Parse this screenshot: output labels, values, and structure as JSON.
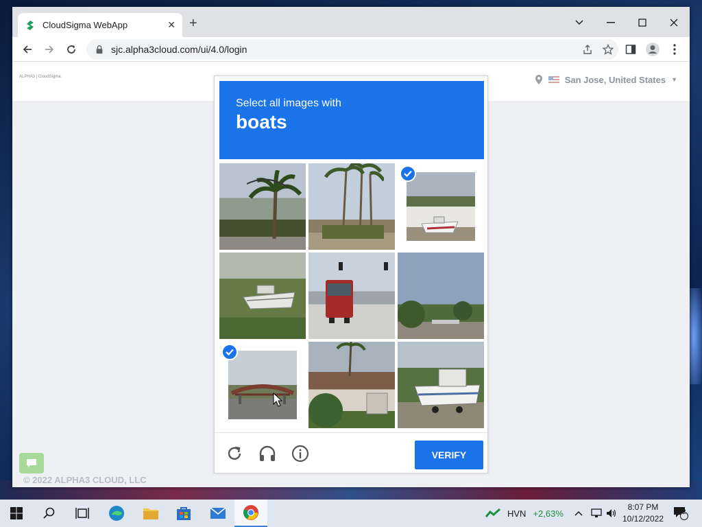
{
  "browser": {
    "tab_title": "CloudSigma WebApp",
    "url": "sjc.alpha3cloud.com/ui/4.0/login"
  },
  "page": {
    "logo_text": "ALPHA3 | CloudSigma",
    "location": "San Jose, United States",
    "footer": "© 2022 ALPHA3 CLOUD, LLC"
  },
  "captcha": {
    "instruction": "Select all images with",
    "target": "boats",
    "verify_label": "VERIFY",
    "tiles": [
      {
        "desc": "palm tree and street light",
        "selected": false
      },
      {
        "desc": "palm trees",
        "selected": false
      },
      {
        "desc": "boat on trailer in driveway",
        "selected": true
      },
      {
        "desc": "boat under tree",
        "selected": false
      },
      {
        "desc": "red bus on street",
        "selected": false
      },
      {
        "desc": "street with trees",
        "selected": false
      },
      {
        "desc": "bridge over road",
        "selected": true
      },
      {
        "desc": "house with palm tree",
        "selected": false
      },
      {
        "desc": "boat on trailer near trees",
        "selected": false
      }
    ]
  },
  "taskbar": {
    "stock_symbol": "HVN",
    "stock_change": "+2,63%",
    "time": "8:07 PM",
    "date": "10/12/2022",
    "notification_count": "2"
  },
  "colors": {
    "accent": "#1a73e8",
    "stock_up": "#1e8e3e"
  }
}
